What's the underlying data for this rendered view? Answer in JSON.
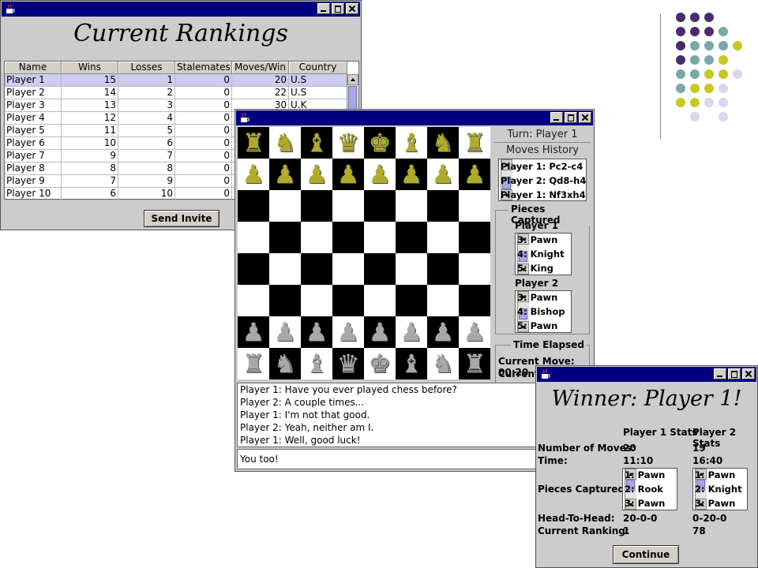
{
  "rankings": {
    "title": "Current Rankings",
    "columns": [
      "Name",
      "Wins",
      "Losses",
      "Stalemates",
      "Moves/Win",
      "Country"
    ],
    "rows": [
      [
        "Player 1",
        "15",
        "1",
        "0",
        "20",
        "U.S"
      ],
      [
        "Player 2",
        "14",
        "2",
        "0",
        "22",
        "U.S"
      ],
      [
        "Player 3",
        "13",
        "3",
        "0",
        "30",
        "U.K"
      ],
      [
        "Player 4",
        "12",
        "4",
        "0",
        "",
        ""
      ],
      [
        "Player 5",
        "11",
        "5",
        "0",
        "",
        ""
      ],
      [
        "Player 6",
        "10",
        "6",
        "0",
        "",
        ""
      ],
      [
        "Player 7",
        "9",
        "7",
        "0",
        "",
        ""
      ],
      [
        "Player 8",
        "8",
        "8",
        "0",
        "",
        ""
      ],
      [
        "Player 9",
        "7",
        "9",
        "0",
        "",
        ""
      ],
      [
        "Player 10",
        "6",
        "10",
        "0",
        "",
        ""
      ]
    ],
    "send_invite_label": "Send Invite"
  },
  "game": {
    "turn": "Turn: Player 1",
    "moves_history_label": "Moves History",
    "moves": [
      "Player 1: Pc2-c4",
      "Player 2: Qd8-h4",
      "Player 1: Nf3xh4"
    ],
    "pieces_captured_label": "Pieces Captured",
    "player1_label": "Player 1",
    "player1_captured": [
      "3: Pawn",
      "4: Knight",
      "5: King"
    ],
    "player2_label": "Player 2",
    "player2_captured": [
      "3: Pawn",
      "4: Bishop",
      "5: Pawn"
    ],
    "time_elapsed_label": "Time Elapsed",
    "current_move_time": "Current Move: 00:20",
    "current_game_time": "Current G",
    "chat_lines": [
      "Player 1: Have you ever played chess before?",
      "Player 2: A couple times...",
      "Player 1: I'm not that good.",
      "Player 2: Yeah, neither am I.",
      "Player 1: Well, good luck!"
    ],
    "chat_input": "You too!",
    "board": {
      "top_back": [
        "♜",
        "♞",
        "♝",
        "♛",
        "♚",
        "♝",
        "♞",
        "♜"
      ],
      "top_pawns": [
        "♟",
        "♟",
        "♟",
        "♟",
        "♟",
        "♟",
        "♟",
        "♟"
      ],
      "bottom_pawns": [
        "♟",
        "♟",
        "♟",
        "♟",
        "♟",
        "♟",
        "♟",
        "♟"
      ],
      "bottom_back": [
        "♜",
        "♞",
        "♝",
        "♛",
        "♚",
        "♝",
        "♞",
        "♜"
      ]
    },
    "colors": {
      "top_pieces": "#b0ac2a",
      "bottom_pieces": "#a8a8a8"
    }
  },
  "winner": {
    "title": "Winner: Player 1!",
    "p1_stats_label": "Player 1 Stats",
    "p2_stats_label": "Player 2 Stats",
    "moves_label": "Number of Moves:",
    "p1_moves": "20",
    "p2_moves": "19",
    "time_label": "Time:",
    "p1_time": "11:10",
    "p2_time": "16:40",
    "captured_label": "Pieces Captured:",
    "p1_captured": [
      "1: Pawn",
      "2: Rook",
      "3: Pawn"
    ],
    "p2_captured": [
      "1: Pawn",
      "2: Knight",
      "3: Pawn"
    ],
    "h2h_label": "Head-To-Head:",
    "p1_h2h": "20-0-0",
    "p2_h2h": "0-20-0",
    "ranking_label": "Current Ranking:",
    "p1_ranking": "1",
    "p2_ranking": "78",
    "continue_label": "Continue"
  },
  "decor": {
    "colors": {
      "purple": "#4a2a70",
      "teal": "#78a8a8",
      "yellow": "#c8c820",
      "lavender": "#d8d8ec"
    }
  }
}
